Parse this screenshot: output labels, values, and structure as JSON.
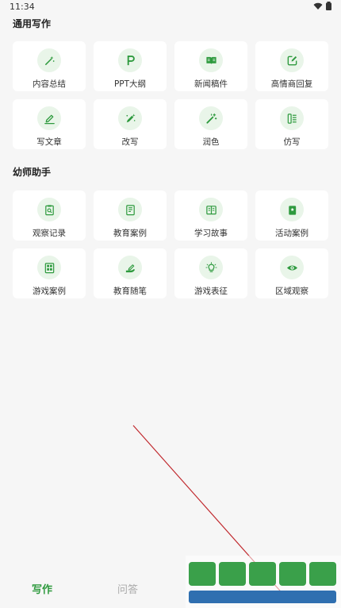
{
  "status_bar": {
    "time": "11:34"
  },
  "sections": [
    {
      "title": "通用写作",
      "items": [
        {
          "label": "内容总结",
          "icon": "sparkle-wand-icon"
        },
        {
          "label": "PPT大纲",
          "icon": "letter-p-icon"
        },
        {
          "label": "新闻稿件",
          "icon": "open-book-icon"
        },
        {
          "label": "高情商回复",
          "icon": "edit-square-icon"
        },
        {
          "label": "写文章",
          "icon": "pen-line-icon"
        },
        {
          "label": "改写",
          "icon": "pen-sparkle-icon"
        },
        {
          "label": "润色",
          "icon": "magic-wand-icon"
        },
        {
          "label": "仿写",
          "icon": "list-doc-icon"
        }
      ]
    },
    {
      "title": "幼师助手",
      "items": [
        {
          "label": "观察记录",
          "icon": "clipboard-search-icon"
        },
        {
          "label": "教育案例",
          "icon": "document-icon"
        },
        {
          "label": "学习故事",
          "icon": "book-icon"
        },
        {
          "label": "活动案例",
          "icon": "star-card-icon"
        },
        {
          "label": "游戏案例",
          "icon": "grid-doc-icon"
        },
        {
          "label": "教育随笔",
          "icon": "hand-pen-icon"
        },
        {
          "label": "游戏表征",
          "icon": "lightbulb-icon"
        },
        {
          "label": "区域观察",
          "icon": "eye-icon"
        }
      ]
    }
  ],
  "bottom_nav": [
    {
      "label": "写作",
      "active": true
    },
    {
      "label": "问答",
      "active": false
    }
  ],
  "colors": {
    "accent": "#2e9a3e",
    "icon_bg": "#e9f5e9",
    "annotation": "#c0282d"
  }
}
